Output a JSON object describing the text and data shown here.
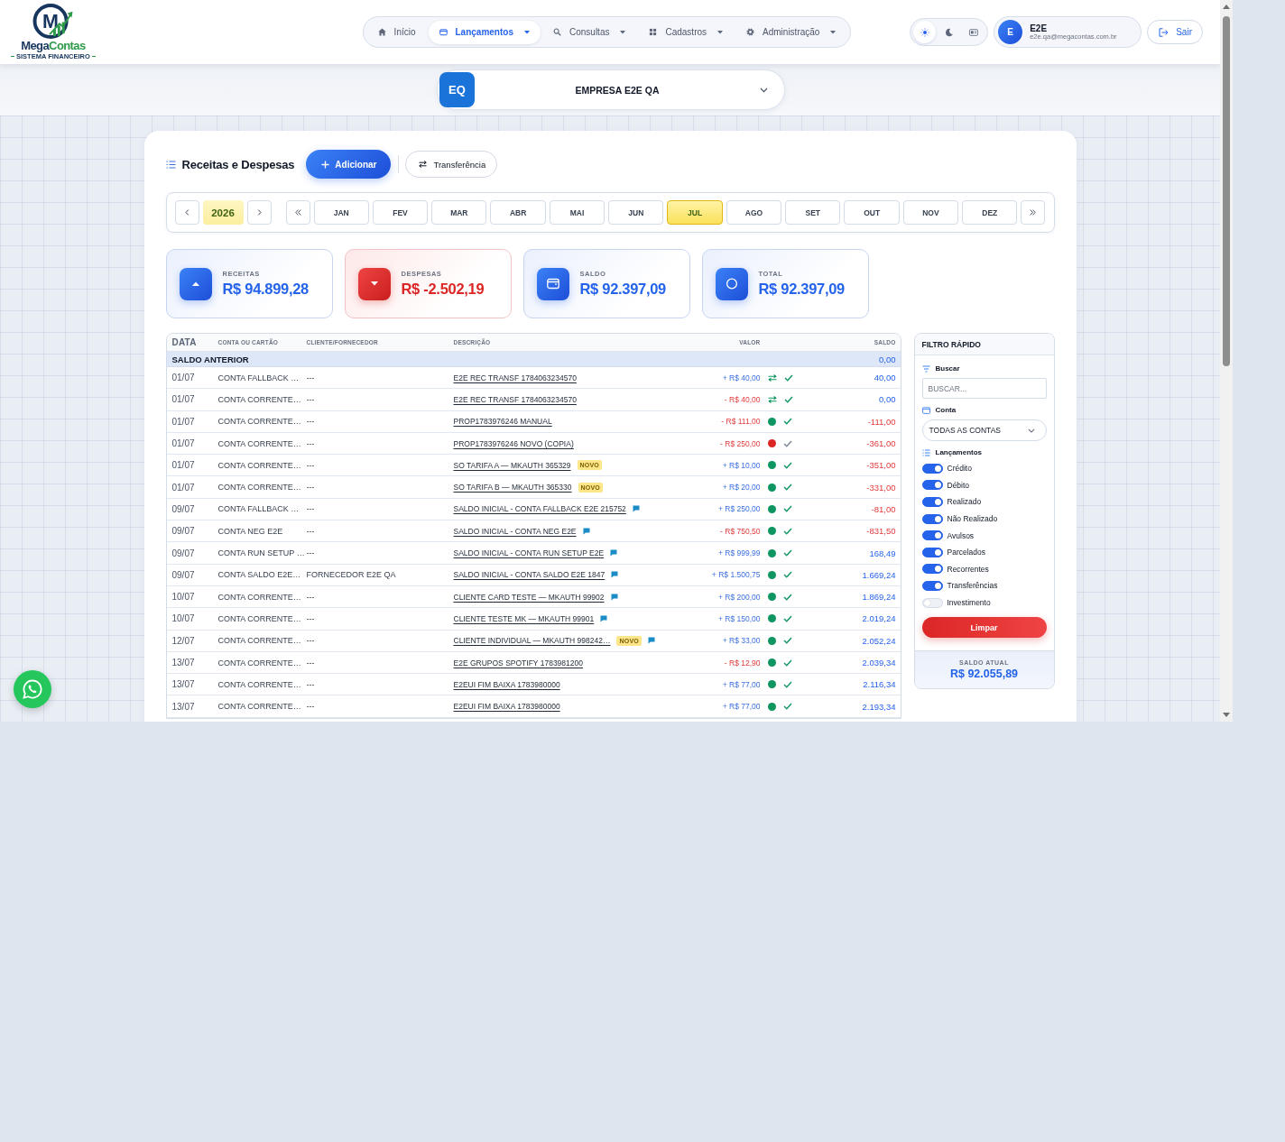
{
  "header": {
    "logo": {
      "monogram": "M",
      "wordmark_main": "Mega",
      "wordmark_accent": "Contas",
      "tagline": "SISTEMA FINANCEIRO"
    },
    "nav": [
      {
        "label": "Início",
        "selected": false,
        "has_menu": false
      },
      {
        "label": "Lançamentos",
        "selected": true,
        "has_menu": true
      },
      {
        "label": "Consultas",
        "selected": false,
        "has_menu": true
      },
      {
        "label": "Cadastros",
        "selected": false,
        "has_menu": true
      },
      {
        "label": "Administração",
        "selected": false,
        "has_menu": true
      }
    ],
    "theme_options": [
      {
        "selected": true
      },
      {
        "selected": false
      },
      {
        "selected": false
      }
    ],
    "user": {
      "initial": "E",
      "name": "E2E",
      "email": "e2e.qa@megacontas.com.br"
    },
    "logout_button": "Sair"
  },
  "company": {
    "initials": "EQ",
    "name": "EMPRESA E2E QA"
  },
  "main": {
    "title": "Receitas e Despesas",
    "add_button": "Adicionar",
    "transfer_button": "Transferência",
    "period": {
      "year": "2026",
      "months": [
        {
          "label": "JAN",
          "selected": false
        },
        {
          "label": "FEV",
          "selected": false
        },
        {
          "label": "MAR",
          "selected": false
        },
        {
          "label": "ABR",
          "selected": false
        },
        {
          "label": "MAI",
          "selected": false
        },
        {
          "label": "JUN",
          "selected": false
        },
        {
          "label": "JUL",
          "selected": true
        },
        {
          "label": "AGO",
          "selected": false
        },
        {
          "label": "SET",
          "selected": false
        },
        {
          "label": "OUT",
          "selected": false
        },
        {
          "label": "NOV",
          "selected": false
        },
        {
          "label": "DEZ",
          "selected": false
        }
      ]
    },
    "summary": [
      {
        "kind": "income",
        "label": "RECEITAS",
        "value": "R$ 94.899,28"
      },
      {
        "kind": "expense",
        "label": "DESPESAS",
        "value": "R$ -2.502,19"
      },
      {
        "kind": "balance",
        "label": "SALDO",
        "value": "R$ 92.397,09"
      },
      {
        "kind": "total",
        "label": "TOTAL",
        "value": "R$ 92.397,09"
      }
    ],
    "table": {
      "columns": [
        "DATA",
        "CONTA OU CARTÃO",
        "CLIENTE/FORNECEDOR",
        "DESCRIÇÃO",
        "VALOR",
        "SALDO"
      ],
      "opening": {
        "label": "SALDO ANTERIOR",
        "balance": "0,00"
      },
      "rows": [
        {
          "date": "01/07",
          "account": "CONTA FALLBACK …",
          "client": "---",
          "description": "E2E REC TRANSF 1784063234570",
          "note": false,
          "amount": "+ R$ 40,00",
          "credit": true,
          "transfer": true,
          "confirmed": true,
          "balance": "40,00",
          "balance_negative": false
        },
        {
          "date": "01/07",
          "account": "CONTA CORRENTE…",
          "client": "---",
          "description": "E2E REC TRANSF 1784063234570",
          "note": false,
          "amount": "- R$ 40,00",
          "credit": false,
          "transfer": true,
          "confirmed": true,
          "balance": "0,00",
          "balance_negative": false
        },
        {
          "date": "01/07",
          "account": "CONTA CORRENTE…",
          "client": "---",
          "description": "PROP1783976246 MANUAL",
          "note": false,
          "amount": "- R$ 111,00",
          "credit": false,
          "transfer": false,
          "color": "#0e9560",
          "confirmed": true,
          "balance": "-111,00",
          "balance_negative": true
        },
        {
          "date": "01/07",
          "account": "CONTA CORRENTE…",
          "client": "---",
          "description": "PROP1783976246 NOVO (COPIA)",
          "note": false,
          "amount": "- R$ 250,00",
          "credit": false,
          "transfer": false,
          "color": "#dc2626",
          "confirmed": false,
          "balance": "-361,00",
          "balance_negative": true
        },
        {
          "date": "01/07",
          "account": "CONTA CORRENTE…",
          "client": "---",
          "description": "SO TARIFA A — MKAUTH 365329",
          "badge": "NOVO",
          "note": false,
          "amount": "+ R$ 10,00",
          "credit": true,
          "transfer": false,
          "color": "#0e9560",
          "confirmed": true,
          "balance": "-351,00",
          "balance_negative": true
        },
        {
          "date": "01/07",
          "account": "CONTA CORRENTE…",
          "client": "---",
          "description": "SO TARIFA B — MKAUTH 365330",
          "badge": "NOVO",
          "note": false,
          "amount": "+ R$ 20,00",
          "credit": true,
          "transfer": false,
          "color": "#0e9560",
          "confirmed": true,
          "balance": "-331,00",
          "balance_negative": true
        },
        {
          "date": "09/07",
          "account": "CONTA FALLBACK …",
          "client": "---",
          "description": "SALDO INICIAL - CONTA FALLBACK E2E 215752",
          "note": true,
          "amount": "+ R$ 250,00",
          "credit": true,
          "transfer": false,
          "color": "#0e9560",
          "confirmed": true,
          "balance": "-81,00",
          "balance_negative": true
        },
        {
          "date": "09/07",
          "account": "CONTA NEG E2E",
          "client": "---",
          "description": "SALDO INICIAL - CONTA NEG E2E",
          "note": true,
          "amount": "- R$ 750,50",
          "credit": false,
          "transfer": false,
          "color": "#0e9560",
          "confirmed": true,
          "balance": "-831,50",
          "balance_negative": true
        },
        {
          "date": "09/07",
          "account": "CONTA RUN SETUP …",
          "client": "---",
          "description": "SALDO INICIAL - CONTA RUN SETUP E2E",
          "note": true,
          "amount": "+ R$ 999,99",
          "credit": true,
          "transfer": false,
          "color": "#0e9560",
          "confirmed": true,
          "balance": "168,49",
          "balance_negative": false
        },
        {
          "date": "09/07",
          "account": "CONTA SALDO E2E…",
          "client": "FORNECEDOR E2E QA",
          "description": "SALDO INICIAL - CONTA SALDO E2E 1847",
          "note": true,
          "amount": "+ R$ 1.500,75",
          "credit": true,
          "transfer": false,
          "color": "#0e9560",
          "confirmed": true,
          "balance": "1.669,24",
          "balance_negative": false
        },
        {
          "date": "10/07",
          "account": "CONTA CORRENTE…",
          "client": "---",
          "description": "CLIENTE CARD TESTE — MKAUTH 99902",
          "note": true,
          "amount": "+ R$ 200,00",
          "credit": true,
          "transfer": false,
          "color": "#0e9560",
          "confirmed": true,
          "balance": "1.869,24",
          "balance_negative": false
        },
        {
          "date": "10/07",
          "account": "CONTA CORRENTE…",
          "client": "---",
          "description": "CLIENTE TESTE MK — MKAUTH 99901",
          "note": true,
          "amount": "+ R$ 150,00",
          "credit": true,
          "transfer": false,
          "color": "#0e9560",
          "confirmed": true,
          "balance": "2.019,24",
          "balance_negative": false
        },
        {
          "date": "12/07",
          "account": "CONTA CORRENTE…",
          "client": "---",
          "description": "CLIENTE INDIVIDUAL — MKAUTH 998242…",
          "badge": "NOVO",
          "note": true,
          "amount": "+ R$ 33,00",
          "credit": true,
          "transfer": false,
          "color": "#0e9560",
          "confirmed": true,
          "balance": "2.052,24",
          "balance_negative": false
        },
        {
          "date": "13/07",
          "account": "CONTA CORRENTE…",
          "client": "---",
          "description": "E2E GRUPOS SPOTIFY 1783981200",
          "note": false,
          "amount": "- R$ 12,90",
          "credit": false,
          "transfer": false,
          "color": "#0e9560",
          "confirmed": true,
          "balance": "2.039,34",
          "balance_negative": false
        },
        {
          "date": "13/07",
          "account": "CONTA CORRENTE…",
          "client": "---",
          "description": "E2EUI FIM BAIXA 1783980000",
          "note": false,
          "amount": "+ R$ 77,00",
          "credit": true,
          "transfer": false,
          "color": "#0e9560",
          "confirmed": true,
          "balance": "2.116,34",
          "balance_negative": false
        },
        {
          "date": "13/07",
          "account": "CONTA CORRENTE…",
          "client": "---",
          "description": "E2EUI FIM BAIXA 1783980000",
          "note": false,
          "amount": "+ R$ 77,00",
          "credit": true,
          "transfer": false,
          "color": "#0e9560",
          "confirmed": true,
          "balance": "2.193,34",
          "balance_negative": false
        }
      ]
    },
    "filter": {
      "title": "FILTRO RÁPIDO",
      "search_label": "Buscar",
      "search": {
        "placeholder": "BUSCAR..."
      },
      "account_label": "Conta",
      "account_select": "TODAS AS CONTAS",
      "entries_label": "Lançamentos",
      "toggles": [
        {
          "label": "Crédito",
          "on": true
        },
        {
          "label": "Débito",
          "on": true
        },
        {
          "label": "Realizado",
          "on": true
        },
        {
          "label": "Não Realizado",
          "on": true
        },
        {
          "label": "Avulsos",
          "on": true
        },
        {
          "label": "Parcelados",
          "on": true
        },
        {
          "label": "Recorrentes",
          "on": true
        },
        {
          "label": "Transferências",
          "on": true
        },
        {
          "label": "Investimento",
          "on": false
        }
      ],
      "clear_button": "Limpar",
      "current_balance_label": "SALDO ATUAL",
      "current_balance": "R$ 92.055,89"
    }
  }
}
